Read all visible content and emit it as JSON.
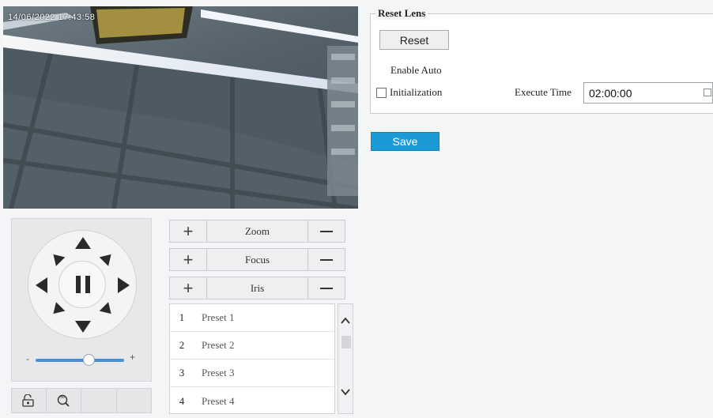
{
  "video": {
    "osd_timestamp": "14/06/2022 17:43:58"
  },
  "ptz": {
    "speed_minus": "-",
    "speed_plus": "+",
    "speed_level": 0.6,
    "tools": [
      "lock-icon",
      "3d-zoom-icon",
      "blank",
      "blank"
    ]
  },
  "lens": {
    "rows": [
      {
        "label": "Zoom",
        "plus": "+",
        "minus": "—"
      },
      {
        "label": "Focus",
        "plus": "+",
        "minus": "—"
      },
      {
        "label": "Iris",
        "plus": "+",
        "minus": "—"
      }
    ]
  },
  "presets": [
    {
      "num": "1",
      "name": "Preset 1"
    },
    {
      "num": "2",
      "name": "Preset 2"
    },
    {
      "num": "3",
      "name": "Preset 3"
    },
    {
      "num": "4",
      "name": "Preset 4"
    }
  ],
  "reset_lens": {
    "legend": "Reset Lens",
    "reset_label": "Reset",
    "enable_auto_label": "Enable Auto",
    "initialization_label": "Initialization",
    "initialization_checked": false,
    "execute_time_label": "Execute Time",
    "execute_time_value": "02:00:00"
  },
  "save_label": "Save",
  "colors": {
    "accent": "#1b9ad8",
    "slider": "#4a8fd0"
  }
}
